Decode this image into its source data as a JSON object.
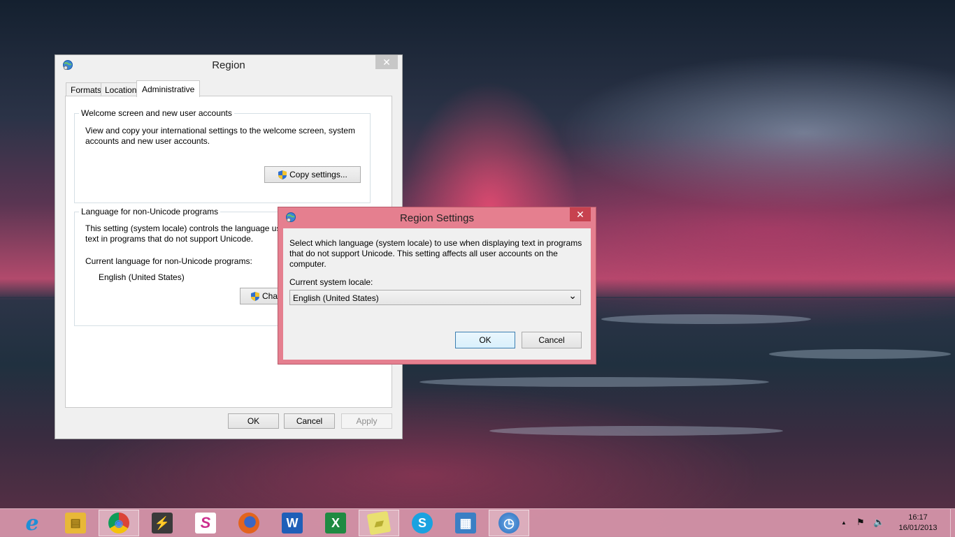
{
  "desktop": {
    "background": "ocean sunset wallpaper"
  },
  "region_dialog": {
    "title": "Region",
    "close_symbol": "✕",
    "tabs": [
      {
        "label": "Formats",
        "active": false
      },
      {
        "label": "Location",
        "active": false
      },
      {
        "label": "Administrative",
        "active": true
      }
    ],
    "welcome_group": {
      "title": "Welcome screen and new user accounts",
      "description_line1": "View and copy your international settings to the welcome screen, system",
      "description_line2": "accounts and new user accounts.",
      "copy_button": "Copy settings..."
    },
    "unicode_group": {
      "title": "Language for non-Unicode programs",
      "description_line1": "This setting (system locale) controls the language us",
      "description_line2": "text in programs that do not support Unicode.",
      "current_label": "Current language for non-Unicode programs:",
      "current_value": "English (United States)",
      "change_button_partial": "Char"
    },
    "buttons": {
      "ok": "OK",
      "cancel": "Cancel",
      "apply": "Apply"
    }
  },
  "region_settings_dialog": {
    "title": "Region Settings",
    "close_symbol": "✕",
    "description_line1": "Select which language (system locale) to use when displaying text in programs",
    "description_line2": "that do not support Unicode. This setting affects all user accounts on the",
    "description_line3": "computer.",
    "locale_label": "Current system locale:",
    "locale_value": "English (United States)",
    "dropdown_arrow": "⌄",
    "buttons": {
      "ok": "OK",
      "cancel": "Cancel"
    },
    "accent_color": "#e57f8f"
  },
  "taskbar": {
    "color": "#d696aa",
    "items": [
      {
        "name": "internet-explorer",
        "glyph": "e",
        "color": "#1e8fd6",
        "active": false
      },
      {
        "name": "file-explorer",
        "glyph": "▤",
        "color": "#e8b838",
        "active": false
      },
      {
        "name": "chrome",
        "glyph": "◉",
        "color": "#2f9d45",
        "active": true
      },
      {
        "name": "winamp",
        "glyph": "⚡",
        "color": "#d88a1c",
        "active": false
      },
      {
        "name": "creative-app",
        "glyph": "S",
        "color": "#cc2f8e",
        "active": false
      },
      {
        "name": "firefox",
        "glyph": "◐",
        "color": "#e2641e",
        "active": false
      },
      {
        "name": "word",
        "glyph": "W",
        "color": "#1f5fb8",
        "active": false
      },
      {
        "name": "excel",
        "glyph": "X",
        "color": "#1f8a42",
        "active": false
      },
      {
        "name": "sticky-notes",
        "glyph": "▰",
        "color": "#e9e070",
        "active": true
      },
      {
        "name": "skype",
        "glyph": "S",
        "color": "#1aa2e0",
        "active": false
      },
      {
        "name": "control-panel",
        "glyph": "▦",
        "color": "#3b7fc4",
        "active": false
      },
      {
        "name": "region-clock",
        "glyph": "◷",
        "color": "#4a8fd0",
        "active": true
      }
    ],
    "tray": {
      "time": "16:17",
      "date": "16/01/2013",
      "up_arrow": "▲",
      "network": "⚑",
      "volume": "🔈"
    }
  }
}
